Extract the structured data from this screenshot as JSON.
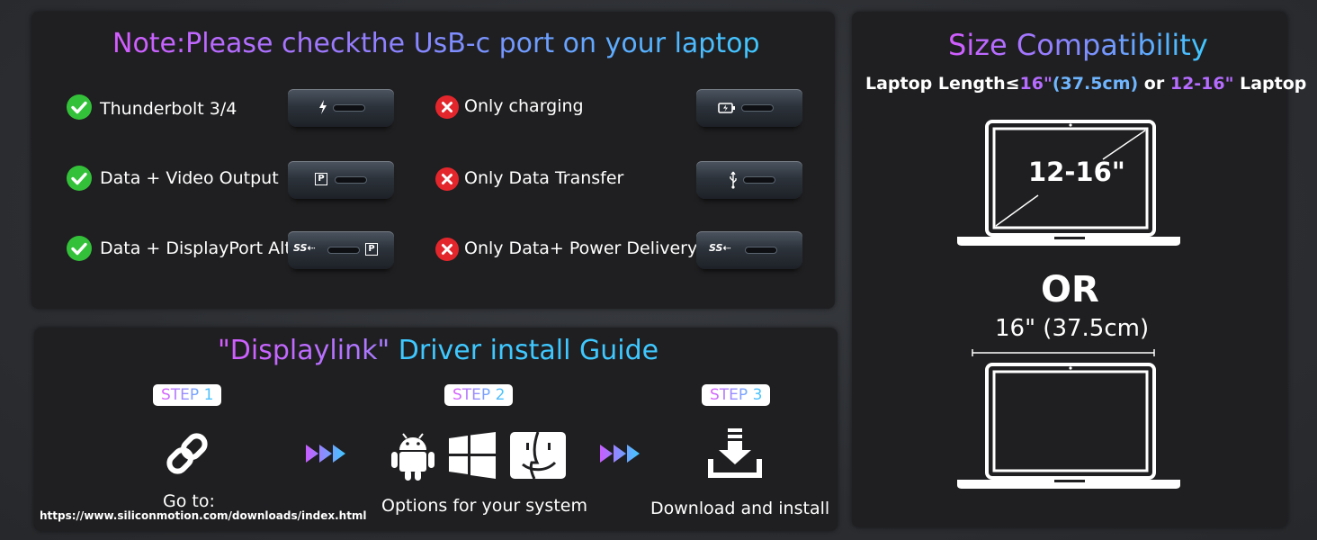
{
  "ports_panel": {
    "title": "Note:Please checkthe UsB-c port on your laptop",
    "supported": [
      {
        "label": "Thunderbolt 3/4",
        "port_icon": "thunderbolt-icon"
      },
      {
        "label": "Data + Video Output",
        "port_icon": "displayport-icon"
      },
      {
        "label": "Data + DisplayPort Alt",
        "port_icon": "ss-usb-displayport-icon"
      }
    ],
    "unsupported": [
      {
        "label": "Only charging",
        "port_icon": "battery-charging-icon"
      },
      {
        "label": "Only Data Transfer",
        "port_icon": "usb-icon"
      },
      {
        "label": "Only Data+ Power Delivery",
        "port_icon": "ss-usb-icon"
      }
    ],
    "port_marks": {
      "dp": "P",
      "ss": "SS"
    }
  },
  "guide_panel": {
    "title_part1": "\"Displaylink\"",
    "title_part2": " Driver install Guide",
    "steps": [
      {
        "pill": "STEP 1",
        "caption": "Go to:",
        "url": "https://www.siliconmotion.com/downloads/index.html",
        "icon": "link-icon"
      },
      {
        "pill": "STEP 2",
        "caption": "Options for your system",
        "icons": [
          "android-icon",
          "windows-icon",
          "mac-finder-icon"
        ]
      },
      {
        "pill": "STEP 3",
        "caption": "Download and install",
        "icon": "download-icon"
      }
    ]
  },
  "size_panel": {
    "title": "Size Compatibility",
    "subtitle_1": "Laptop Length≤",
    "subtitle_2": "16\"",
    "subtitle_3": "(37.5cm)",
    "subtitle_4": " or ",
    "subtitle_5": "12-16\"",
    "subtitle_6": " Laptop",
    "laptop1_label": "12-16\"",
    "or_label": "OR",
    "laptop2_label": "16\" (37.5cm)"
  },
  "colors": {
    "accent_purple": "#d45cff",
    "accent_cyan": "#3fc8ff",
    "ok_green": "#34c13a",
    "no_red": "#e3262c",
    "panel_bg": "#1f1f21"
  }
}
